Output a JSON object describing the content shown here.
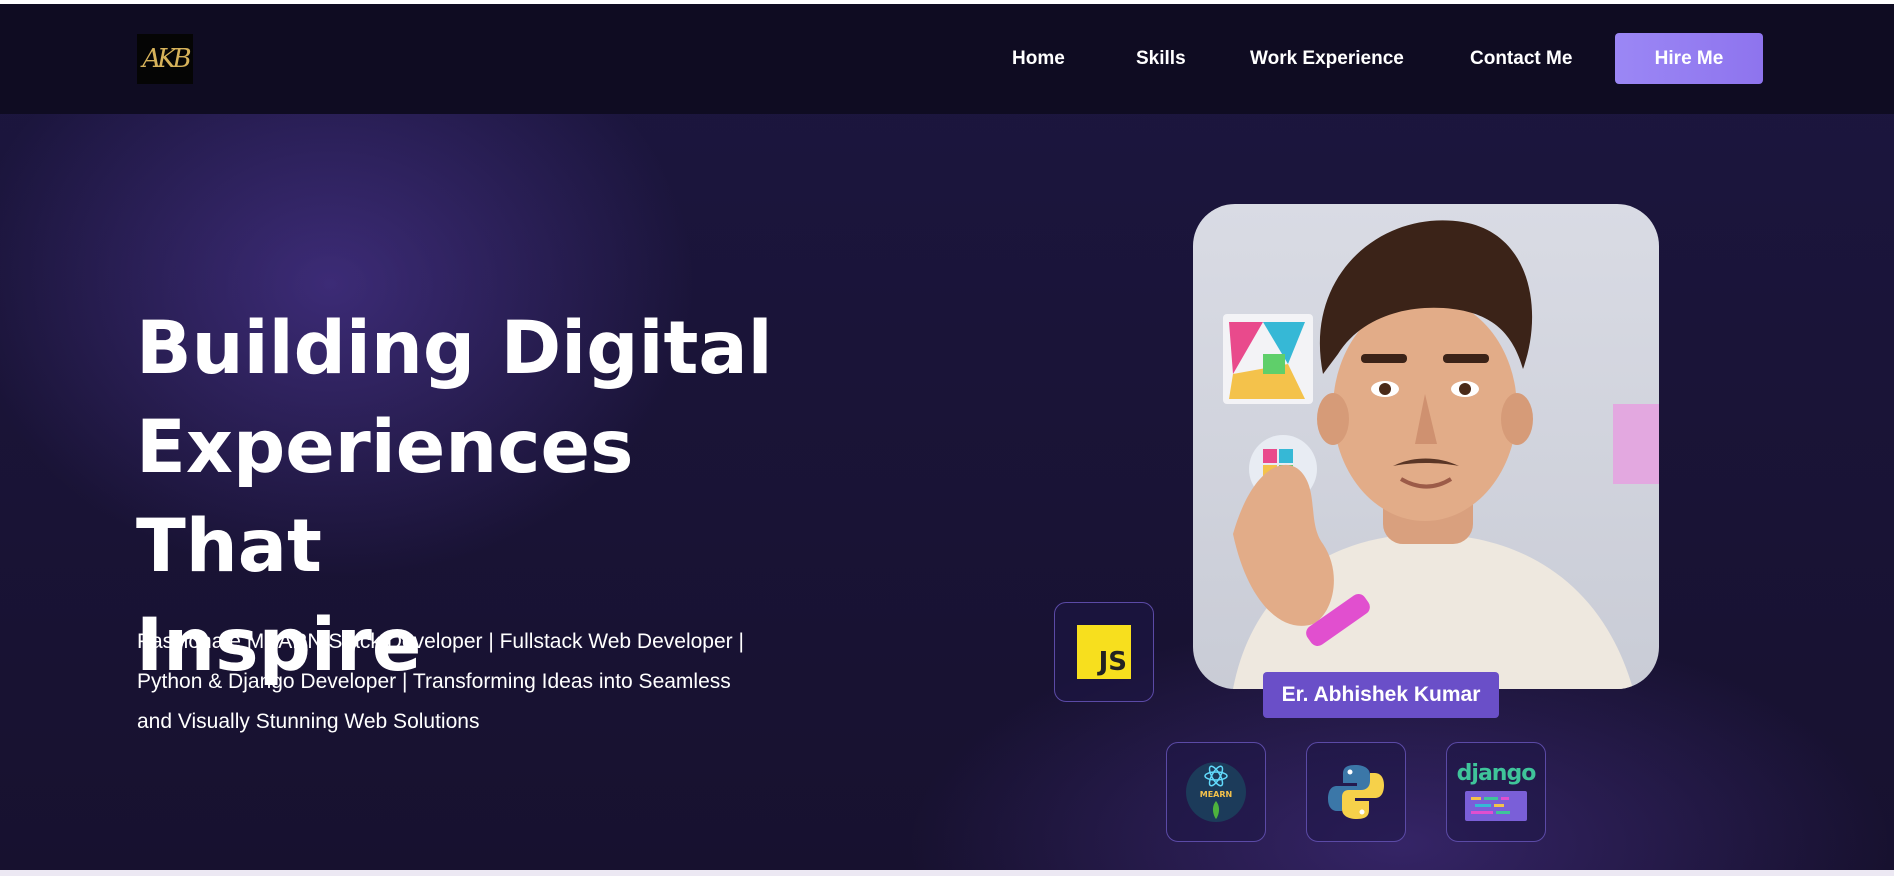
{
  "header": {
    "logo_text": "AKB",
    "nav": [
      "Home",
      "Skills",
      "Work Experience",
      "Contact Me"
    ],
    "hire_button": "Hire Me"
  },
  "hero": {
    "title_lines": [
      "Building Digital",
      "Experiences That",
      "Inspire"
    ],
    "subtitle_lines": [
      "Passionate MEARN Stack Developer | Fullstack Web Developer |",
      "Python & Django Developer | Transforming Ideas into Seamless",
      "and Visually Stunning Web Solutions"
    ]
  },
  "profile": {
    "name": "Er. Abhishek Kumar",
    "photo": "avatar-portrait"
  },
  "skill_tiles": {
    "js_label": "JS",
    "mearn_label": "MEARN",
    "django_label": "django"
  },
  "colors": {
    "accent": "#9b87f5",
    "name_tag": "#6a4fc8",
    "background": "#1a1438",
    "header": "#0f0c22"
  }
}
